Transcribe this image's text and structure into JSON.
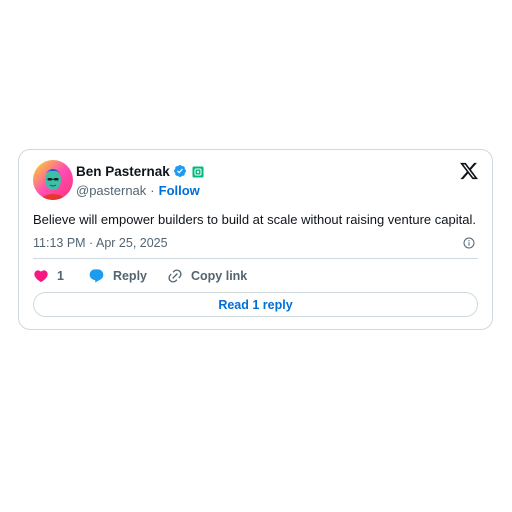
{
  "author": {
    "display_name": "Ben Pasternak",
    "handle": "@pasternak",
    "separator": "·",
    "follow_label": "Follow"
  },
  "tweet": {
    "text": "Believe will empower builders to build at scale without raising venture capital.",
    "timestamp": "11:13 PM · Apr 25, 2025"
  },
  "actions": {
    "like_count": "1",
    "reply_label": "Reply",
    "copy_link_label": "Copy link"
  },
  "read_replies_label": "Read 1 reply",
  "colors": {
    "accent": "#006fd6",
    "like_heart": "#f91880",
    "verified_badge": "#1d9bf0",
    "affiliate_badge": "#00ba7c",
    "border": "#cfd9de",
    "secondary_text": "#536471"
  },
  "icons": {
    "verified": "verified-badge-icon",
    "affiliate": "affiliate-badge-icon",
    "brand": "x-logo-icon",
    "info": "info-icon",
    "like": "heart-icon",
    "reply": "speech-bubble-icon",
    "copy_link": "link-icon"
  }
}
